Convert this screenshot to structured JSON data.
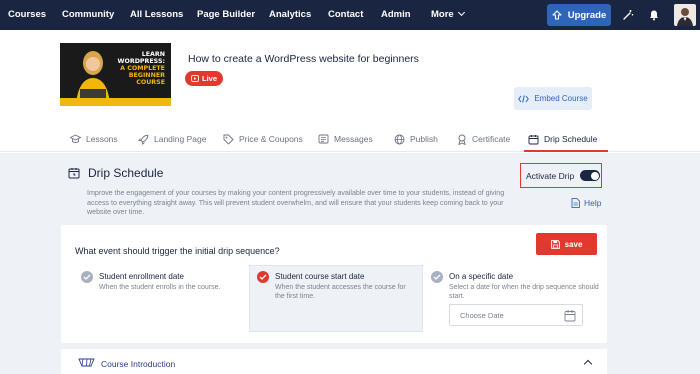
{
  "nav": {
    "items": [
      "Courses",
      "Community",
      "All Lessons",
      "Page Builder",
      "Analytics",
      "Contact",
      "Admin"
    ],
    "more_label": "More",
    "upgrade_label": "Upgrade"
  },
  "course": {
    "title": "How to create a WordPress website for beginners",
    "status_badge": "Live",
    "embed_label": "Embed Course",
    "thumbnail": {
      "line1": "LEARN",
      "line2": "WORDPRESS:",
      "line3": "A COMPLETE",
      "line4": "BEGINNER COURSE"
    }
  },
  "tabs": [
    {
      "label": "Lessons",
      "icon": "graduation-cap-icon"
    },
    {
      "label": "Landing Page",
      "icon": "rocket-icon"
    },
    {
      "label": "Price & Coupons",
      "icon": "tag-icon"
    },
    {
      "label": "Messages",
      "icon": "message-icon"
    },
    {
      "label": "Publish",
      "icon": "globe-icon"
    },
    {
      "label": "Certificate",
      "icon": "award-icon"
    },
    {
      "label": "Drip Schedule",
      "icon": "calendar-icon",
      "active": true
    }
  ],
  "drip": {
    "title": "Drip Schedule",
    "description": "Improve the engagement of your courses by making your content progressively available over time to your students, instead of giving access to everything straight away. This will prevent student overwhelm, and will ensure that your students keep coming back to your website over time.",
    "activate_label": "Activate Drip",
    "activate_on": true,
    "help_label": "Help",
    "question": "What event should trigger the initial drip sequence?",
    "save_label": "save",
    "options": [
      {
        "title": "Student enrollment date",
        "subtitle": "When the student enrolls in the course.",
        "selected": false
      },
      {
        "title": "Student course start date",
        "subtitle": "When the student accesses the course for the first time.",
        "selected": true
      },
      {
        "title": "On a specific date",
        "subtitle": "Select a date for when the drip sequence should start.",
        "selected": false
      }
    ],
    "date_placeholder": "Choose Date",
    "section_title": "Course Introduction"
  },
  "colors": {
    "nav_bg": "#1a2541",
    "accent_red": "#e2392f",
    "brand_blue": "#2f65b8",
    "content_bg": "#eef2f6"
  }
}
